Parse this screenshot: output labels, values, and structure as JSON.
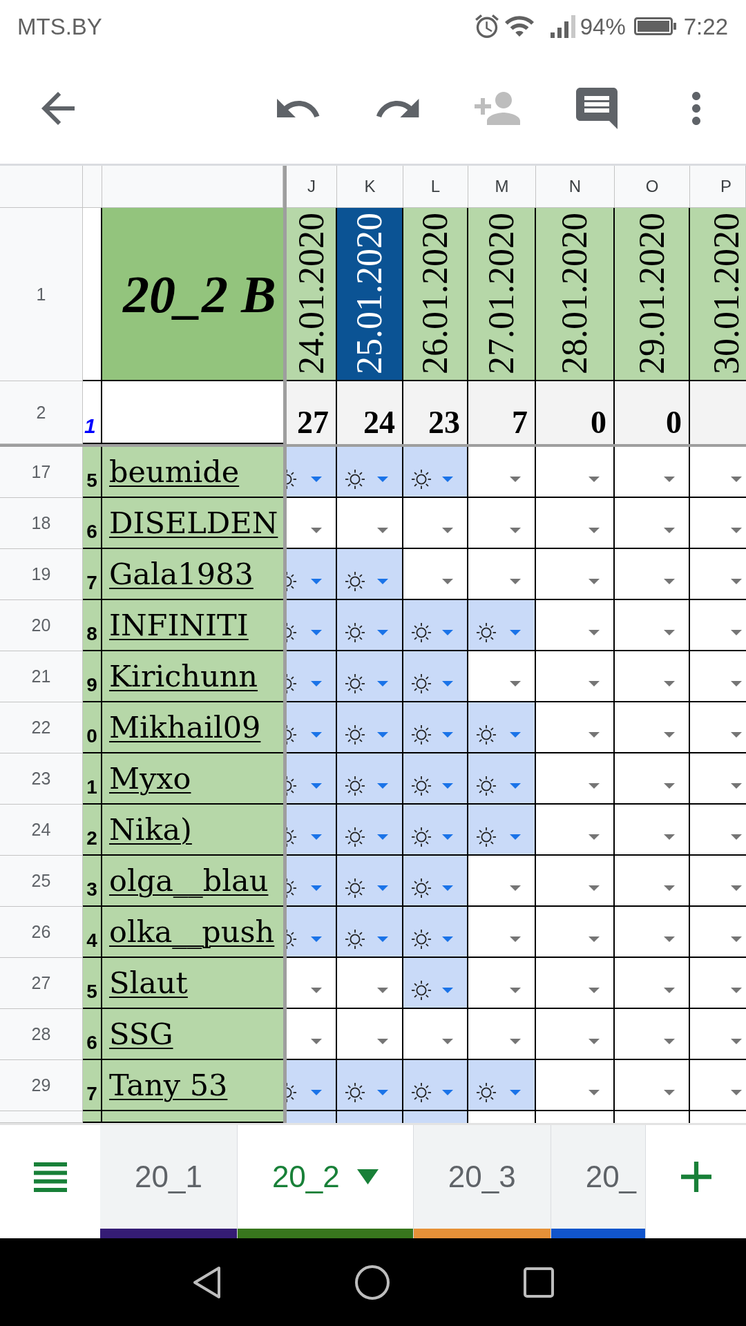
{
  "status_bar": {
    "carrier": "MTS.BY",
    "battery": "94%",
    "time": "7:22"
  },
  "toolbar": [
    {
      "kind": "back",
      "disabled": false
    },
    {
      "kind": "undo",
      "disabled": false
    },
    {
      "kind": "redo",
      "disabled": false
    },
    {
      "kind": "add_person",
      "disabled": true
    },
    {
      "kind": "comments",
      "disabled": false
    },
    {
      "kind": "more",
      "disabled": false
    }
  ],
  "sheet": {
    "columns": [
      {
        "letter": "J",
        "date": "24.01.2020",
        "highlighted": false,
        "total": "27"
      },
      {
        "letter": "K",
        "date": "25.01.2020",
        "highlighted": true,
        "total": "24"
      },
      {
        "letter": "L",
        "date": "26.01.2020",
        "highlighted": false,
        "total": "23"
      },
      {
        "letter": "M",
        "date": "27.01.2020",
        "highlighted": false,
        "total": "7"
      },
      {
        "letter": "N",
        "date": "28.01.2020",
        "highlighted": false,
        "total": "0"
      },
      {
        "letter": "O",
        "date": "29.01.2020",
        "highlighted": false,
        "total": "0"
      },
      {
        "letter": "P",
        "date": "30.01.2020",
        "highlighted": false
      }
    ],
    "title_row": {
      "number": "1",
      "title": "20_2 B"
    },
    "totals_row": {
      "number": "2",
      "index": "1"
    },
    "rows": [
      {
        "number": "17",
        "index": "5",
        "name": "beumide",
        "cells": [
          {
            "marked": true
          },
          {
            "marked": true
          },
          {
            "marked": true
          },
          {
            "marked": false
          },
          {
            "marked": false
          },
          {
            "marked": false
          },
          {
            "marked": false
          }
        ]
      },
      {
        "number": "18",
        "index": "6",
        "name": "DISELDEN",
        "cells": [
          {
            "marked": false
          },
          {
            "marked": false
          },
          {
            "marked": false
          },
          {
            "marked": false
          },
          {
            "marked": false
          },
          {
            "marked": false
          },
          {
            "marked": false
          }
        ]
      },
      {
        "number": "19",
        "index": "7",
        "name": "Gala1983",
        "cells": [
          {
            "marked": true
          },
          {
            "marked": true
          },
          {
            "marked": false
          },
          {
            "marked": false
          },
          {
            "marked": false
          },
          {
            "marked": false
          },
          {
            "marked": false
          }
        ]
      },
      {
        "number": "20",
        "index": "8",
        "name": "INFINITI",
        "cells": [
          {
            "marked": true
          },
          {
            "marked": true
          },
          {
            "marked": true
          },
          {
            "marked": true
          },
          {
            "marked": false
          },
          {
            "marked": false
          },
          {
            "marked": false
          }
        ]
      },
      {
        "number": "21",
        "index": "9",
        "name": "Kirichunn",
        "cells": [
          {
            "marked": true
          },
          {
            "marked": true
          },
          {
            "marked": true
          },
          {
            "marked": false
          },
          {
            "marked": false
          },
          {
            "marked": false
          },
          {
            "marked": false
          }
        ]
      },
      {
        "number": "22",
        "index": "0",
        "name": "Mikhail09",
        "cells": [
          {
            "marked": true
          },
          {
            "marked": true
          },
          {
            "marked": true
          },
          {
            "marked": true
          },
          {
            "marked": false
          },
          {
            "marked": false
          },
          {
            "marked": false
          }
        ]
      },
      {
        "number": "23",
        "index": "1",
        "name": "Myxo",
        "cells": [
          {
            "marked": true
          },
          {
            "marked": true
          },
          {
            "marked": true
          },
          {
            "marked": true
          },
          {
            "marked": false
          },
          {
            "marked": false
          },
          {
            "marked": false
          }
        ]
      },
      {
        "number": "24",
        "index": "2",
        "name": "Nika)",
        "cells": [
          {
            "marked": true
          },
          {
            "marked": true
          },
          {
            "marked": true
          },
          {
            "marked": true
          },
          {
            "marked": false
          },
          {
            "marked": false
          },
          {
            "marked": false
          }
        ]
      },
      {
        "number": "25",
        "index": "3",
        "name": "olga__blau",
        "cells": [
          {
            "marked": true
          },
          {
            "marked": true
          },
          {
            "marked": true
          },
          {
            "marked": false
          },
          {
            "marked": false
          },
          {
            "marked": false
          },
          {
            "marked": false
          }
        ]
      },
      {
        "number": "26",
        "index": "4",
        "name": "olka__push",
        "cells": [
          {
            "marked": true
          },
          {
            "marked": true
          },
          {
            "marked": true
          },
          {
            "marked": false
          },
          {
            "marked": false
          },
          {
            "marked": false
          },
          {
            "marked": false
          }
        ]
      },
      {
        "number": "27",
        "index": "5",
        "name": "Slaut",
        "cells": [
          {
            "marked": false
          },
          {
            "marked": false
          },
          {
            "marked": true
          },
          {
            "marked": false
          },
          {
            "marked": false
          },
          {
            "marked": false
          },
          {
            "marked": false
          }
        ]
      },
      {
        "number": "28",
        "index": "6",
        "name": "SSG",
        "cells": [
          {
            "marked": false
          },
          {
            "marked": false
          },
          {
            "marked": false
          },
          {
            "marked": false
          },
          {
            "marked": false
          },
          {
            "marked": false
          },
          {
            "marked": false
          }
        ]
      },
      {
        "number": "29",
        "index": "7",
        "name": "Tany 53",
        "cells": [
          {
            "marked": true
          },
          {
            "marked": true
          },
          {
            "marked": true
          },
          {
            "marked": true
          },
          {
            "marked": false
          },
          {
            "marked": false
          },
          {
            "marked": false
          }
        ]
      },
      {
        "cells": [
          {
            "marked": true
          },
          {
            "marked": true
          },
          {
            "marked": true
          },
          {
            "marked": false
          },
          {
            "marked": false
          },
          {
            "marked": false
          },
          {
            "marked": false
          }
        ]
      }
    ]
  },
  "sheet_tabs": [
    {
      "label": "20_1",
      "selected": false,
      "color": "#351c75"
    },
    {
      "label": "20_2",
      "selected": true,
      "color": "#38761d"
    },
    {
      "label": "20_3",
      "selected": false,
      "color": "#e69138"
    },
    {
      "label": "20_",
      "selected": false,
      "color": "#1155cc"
    }
  ]
}
